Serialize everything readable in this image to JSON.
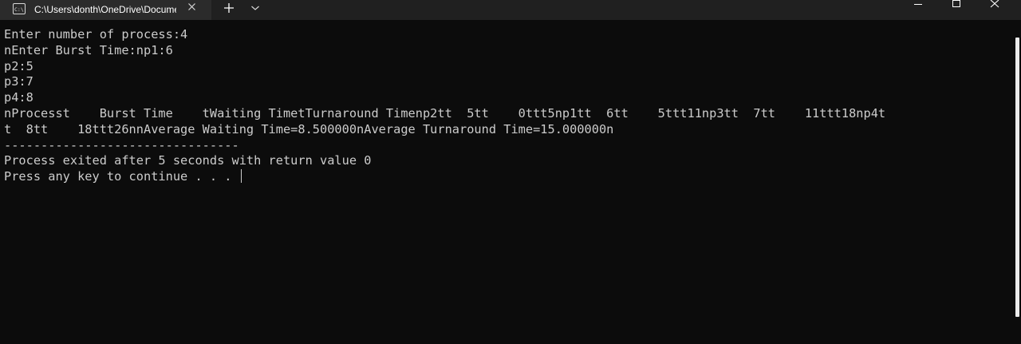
{
  "tab": {
    "title": "C:\\Users\\donth\\OneDrive\\Documents\\fcfs.exe",
    "icon": "console-app-icon"
  },
  "titlebar": {
    "new_tab_symbol": "+",
    "dropdown_icon": "chevron-down-icon",
    "buttons": [
      "minimize-icon",
      "maximize-icon",
      "close-icon"
    ]
  },
  "console": {
    "lines": [
      "Enter number of process:4",
      "nEnter Burst Time:np1:6",
      "p2:5",
      "p3:7",
      "p4:8",
      "nProcesst    Burst Time    tWaiting TimetTurnaround Timenp2tt  5tt    0ttt5np1tt  6tt    5ttt11np3tt  7tt    11ttt18np4t",
      "t  8tt    18ttt26nnAverage Waiting Time=8.500000nAverage Turnaround Time=15.000000n",
      "--------------------------------",
      "Process exited after 5 seconds with return value 0",
      "Press any key to continue . . . "
    ]
  },
  "colors": {
    "background": "#0c0c0c",
    "tabbar": "#202020",
    "active_tab": "#2b2b2b",
    "text": "#cccccc"
  }
}
